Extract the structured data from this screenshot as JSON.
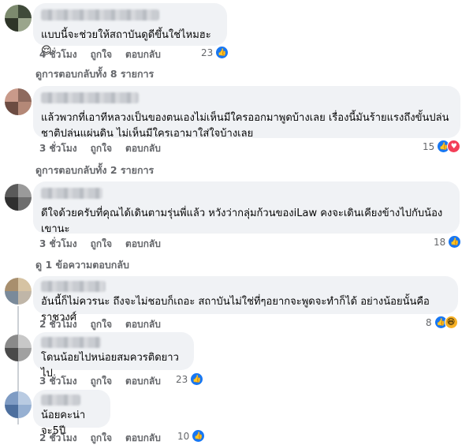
{
  "colors": {
    "link_gray": "#65676b",
    "bubble_bg": "#f0f2f5",
    "like_blue": "#1877f2",
    "love_red": "#f33e58",
    "haha_yellow": "#f7b125"
  },
  "comments": [
    {
      "text": "แบบนี้จะช่วยให้สถาบันดูดีขึ้นใช่ไหมฮะ",
      "emoji": "😌",
      "time": "4 ชั่วโมง",
      "like": "ถูกใจ",
      "reply": "ตอบกลับ",
      "reaction_count": "23",
      "reactions": [
        "like-icon"
      ],
      "view_replies": "ดูการตอบกลับทั้ง 8 รายการ"
    },
    {
      "text": "แล้วพวกที่เอาทีหลวงเป็นของตนเองไม่เห็นมีใครออกมาพูดบ้างเลย เรื่องนี้มันร้ายแรงถึงขั้นปล่นชาติปล่นแผ่นดิน ไม่เห็นมีใครเอามาใส่ใจบ้างเลย",
      "time": "3 ชั่วโมง",
      "like": "ถูกใจ",
      "reply": "ตอบกลับ",
      "reaction_count": "15",
      "reactions": [
        "like-icon",
        "love-icon"
      ],
      "view_replies": "ดูการตอบกลับทั้ง 2 รายการ"
    },
    {
      "text": "ดีใจด้วยครับที่คุณได้เดินตามรุ่นพี่แล้ว หวังว่ากลุ่มก้วนของiLaw คงจะเดินเคียงข้างไปกับน้องเขานะ",
      "time": "3 ชั่วโมง",
      "like": "ถูกใจ",
      "reply": "ตอบกลับ",
      "reaction_count": "18",
      "reactions": [
        "like-icon"
      ],
      "view_replies": "ดู 1 ข้อความตอบกลับ"
    },
    {
      "text": "อันนี้ก็ไม่ควรนะ ถึงจะไม่ชอบก็เถอะ สถาบันไม่ใช่ที่ๆอยากจะพูดจะทำก็ได้ อย่างน้อยนั้นคือราชวงศ์",
      "time": "2 ชั่วโมง",
      "like": "ถูกใจ",
      "reply": "ตอบกลับ",
      "reaction_count": "8",
      "reactions": [
        "like-icon",
        "haha-icon"
      ]
    },
    {
      "text": "โดนน้อยไปหน่อยสมควรติดยาวไป",
      "time": "3 ชั่วโมง",
      "like": "ถูกใจ",
      "reply": "ตอบกลับ",
      "reaction_count": "23",
      "reactions": [
        "like-icon"
      ]
    },
    {
      "text": "น้อยคะน่าจะ5ปี",
      "time": "2 ชั่วโมง",
      "like": "ถูกใจ",
      "reply": "ตอบกลับ",
      "reaction_count": "10",
      "reactions": [
        "like-icon"
      ]
    }
  ]
}
